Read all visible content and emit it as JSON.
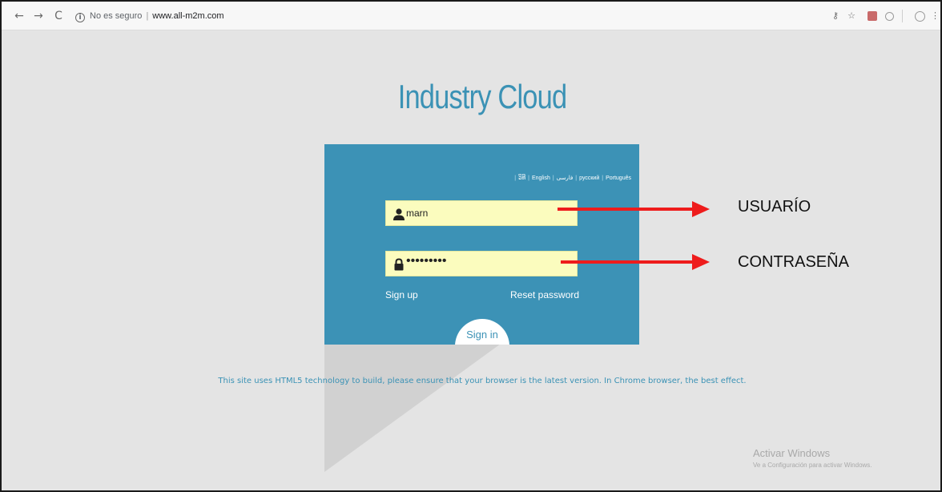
{
  "browser": {
    "nav": {
      "back": "←",
      "forward": "→",
      "reload": "C"
    },
    "security_text": "No es seguro",
    "url": "www.all-m2m.com",
    "icons": [
      "key-icon",
      "star-icon",
      "pdf-extension-icon",
      "circle-extension-icon",
      "profile-icon",
      "menu-icon"
    ]
  },
  "page": {
    "title": "Industry Cloud",
    "languages": [
      "ວິທີ",
      "English",
      "فارسی",
      "русский",
      "Português"
    ],
    "username": {
      "value": "marn"
    },
    "password": {
      "value": "•••••••••"
    },
    "signup_label": "Sign up",
    "reset_label": "Reset password",
    "signin_label": "Sign in",
    "notice": "This site uses HTML5 technology to build, please ensure that your browser is the latest version. In Chrome browser, the best effect."
  },
  "annotations": {
    "user_label": "USUARÍO",
    "password_label": "CONTRASEÑA",
    "arrow_color": "#ee1c1c"
  },
  "watermark": {
    "line1": "Activar Windows",
    "line2": "Ve a Configuración para activar Windows."
  },
  "colors": {
    "accent": "#3c92b6",
    "field_bg": "#fbfcbe",
    "page_bg": "#e4e4e4"
  }
}
